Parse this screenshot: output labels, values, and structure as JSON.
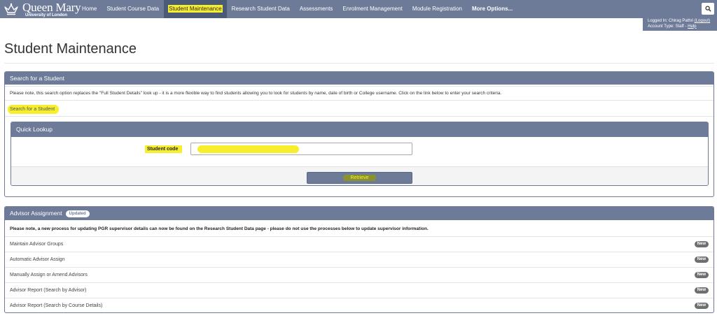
{
  "logo": {
    "name": "Queen Mary",
    "sub": "University of London"
  },
  "nav": {
    "items": [
      {
        "label": "Home"
      },
      {
        "label": "Student Course Data"
      },
      {
        "label": "Student Maintenance"
      },
      {
        "label": "Research Student Data"
      },
      {
        "label": "Assessments"
      },
      {
        "label": "Enrolment Management"
      },
      {
        "label": "Module Registration"
      },
      {
        "label": "More Options..."
      }
    ]
  },
  "login": {
    "prefix": "Logged In: Chirag Pathri",
    "logout": "(Logout)",
    "account_prefix": "Account Type: Staff -",
    "help": "Help"
  },
  "page_title": "Student Maintenance",
  "search_panel": {
    "heading": "Search for a Student",
    "notice": "Please note, this search option replaces the \"Full Student Details\" look up - it is a more flexible way to find students allowing you to look for students by name, date of birth or College username. Click on the link below to enter your search criteria.",
    "link": "Search for a Student"
  },
  "quick_lookup": {
    "heading": "Quick Lookup",
    "label": "Student code",
    "input_value": "",
    "button": "Retrieve"
  },
  "advisor": {
    "heading": "Advisor Assignment",
    "badge": "Updated",
    "notice": "Please note, a new process for updating PGR supervisor details can now be found on the Research Student Data page - please do not use the processes below to update supervisor information.",
    "rows": [
      {
        "label": "Maintain Advisor Groups",
        "badge": "New"
      },
      {
        "label": "Automatic Advisor Assign",
        "badge": "New"
      },
      {
        "label": "Manually Assign or Amend Advisors",
        "badge": "New"
      },
      {
        "label": "Advisor Report (Search by Advisor)",
        "badge": "New"
      },
      {
        "label": "Advisor Report (Search by Course Details)",
        "badge": "New"
      }
    ]
  },
  "colors": {
    "nav": "#6d7b98",
    "nav_active": "#4b5a76",
    "highlight": "#f7ef2d"
  }
}
